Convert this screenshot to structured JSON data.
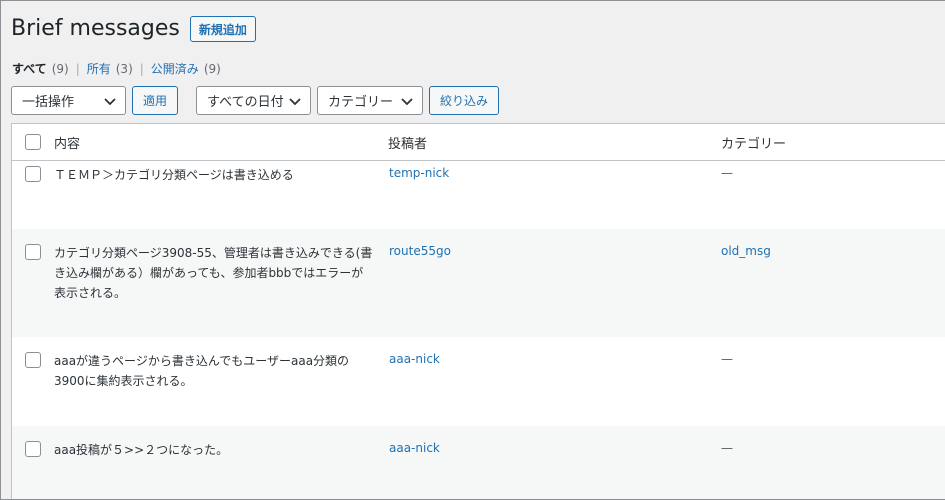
{
  "header": {
    "title": "Brief messages",
    "add_new_label": "新規追加"
  },
  "views": [
    {
      "label": "すべて",
      "count": "(9)"
    },
    {
      "label": "所有",
      "count": "(3)"
    },
    {
      "label": "公開済み",
      "count": "(9)"
    }
  ],
  "filters": {
    "bulk_action": "一括操作",
    "apply": "適用",
    "dates": "すべての日付",
    "category": "カテゴリー",
    "filter": "絞り込み"
  },
  "table": {
    "columns": {
      "content": "内容",
      "author": "投稿者",
      "category": "カテゴリー"
    },
    "rows": [
      {
        "content": "ＴＥＭＰ＞カテゴリ分類ページは書き込める",
        "author": "temp-nick",
        "category": "—"
      },
      {
        "content": "カテゴリ分類ページ3908-55、管理者は書き込みできる(書き込み欄がある）欄があっても、参加者bbbではエラーが表示される。",
        "author": "route55go",
        "category": "old_msg"
      },
      {
        "content": "aaaが違うページから書き込んでもユーザーaaa分類の3900に集約表示される。",
        "author": "aaa-nick",
        "category": "—"
      },
      {
        "content": "aaa投稿が５>>２つになった。",
        "author": "aaa-nick",
        "category": "—"
      }
    ]
  }
}
